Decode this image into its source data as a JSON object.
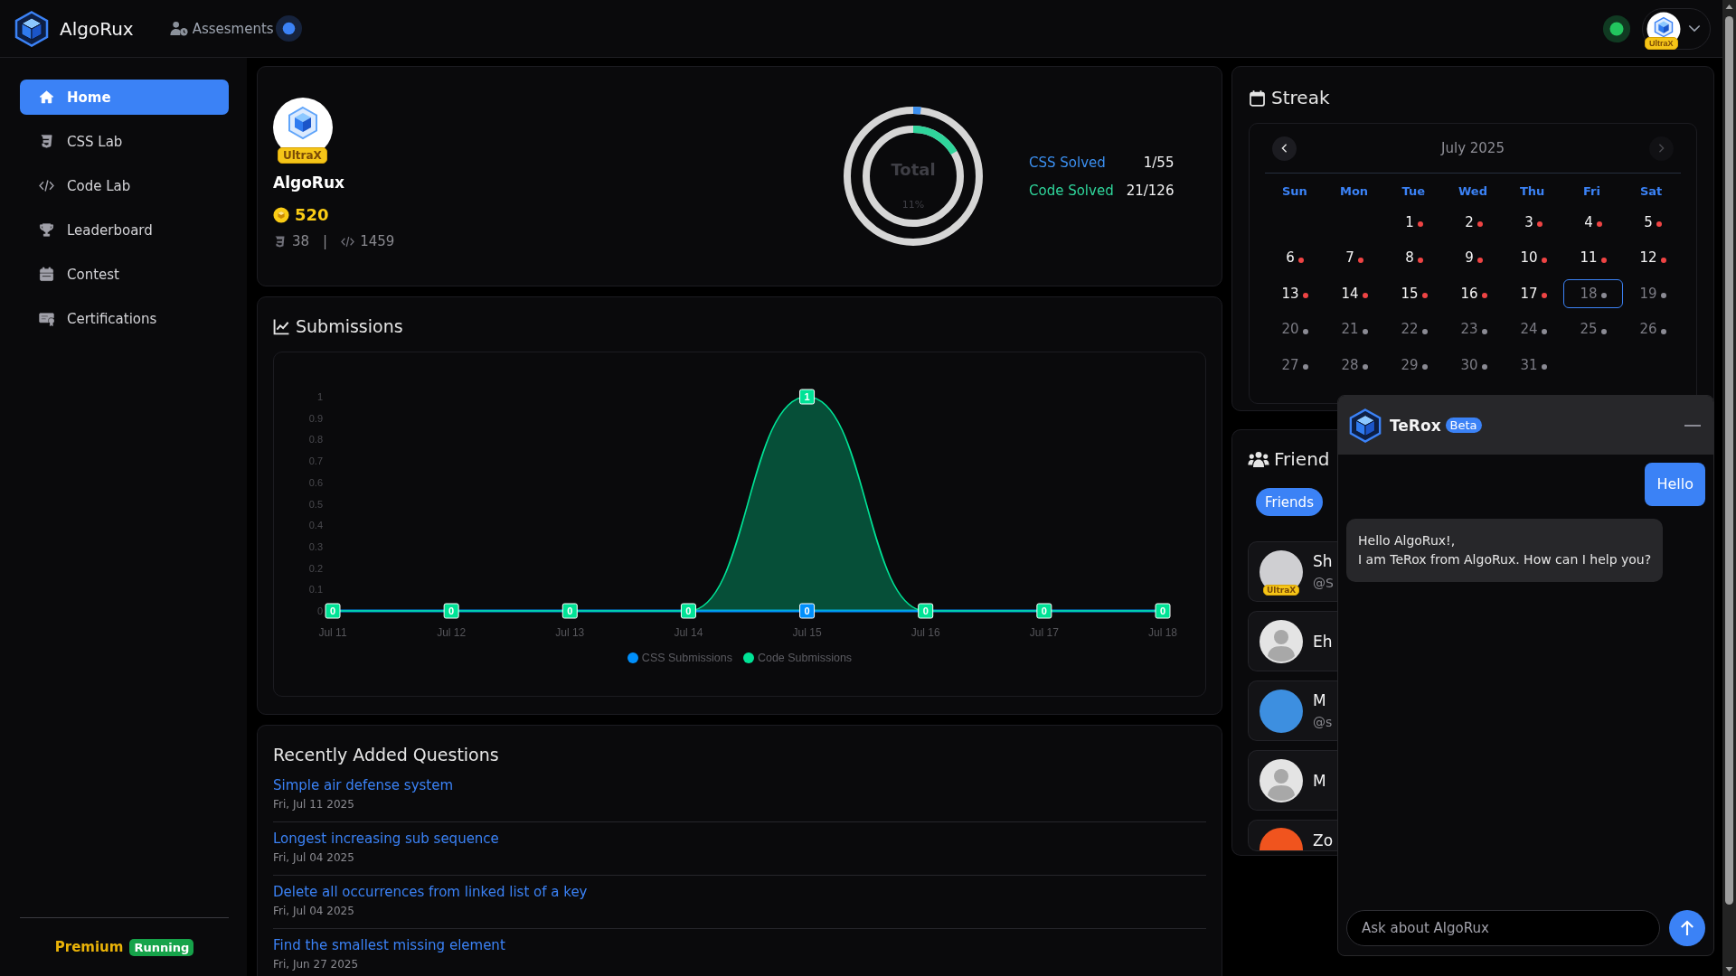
{
  "topbar": {
    "brand": "AlgoRux",
    "link": "Assesments",
    "account_badge": "UltraX"
  },
  "sidebar": {
    "items": [
      {
        "label": "Home",
        "selected": true
      },
      {
        "label": "CSS Lab",
        "selected": false
      },
      {
        "label": "Code Lab",
        "selected": false
      },
      {
        "label": "Leaderboard",
        "selected": false
      },
      {
        "label": "Contest",
        "selected": false
      },
      {
        "label": "Certifications",
        "selected": false
      }
    ],
    "plan": "Premium",
    "plan_status": "Running"
  },
  "profile": {
    "badge": "UltraX",
    "name": "AlgoRux",
    "coins": "520",
    "css_count": "38",
    "separator": "|",
    "code_count": "1459"
  },
  "progress": {
    "center_label": "Total",
    "percent": "11%",
    "rings": [
      {
        "label": "CSS Solved",
        "value": "1/55",
        "color": "#3b8ff0"
      },
      {
        "label": "Code Solved",
        "value": "21/126",
        "color": "#2fd59b"
      }
    ]
  },
  "streak": {
    "title": "Streak",
    "month": "July 2025",
    "prev_disabled": false,
    "next_disabled": true,
    "weekdays": [
      "Sun",
      "Mon",
      "Tue",
      "Wed",
      "Thu",
      "Fri",
      "Sat"
    ],
    "weeks": [
      [
        {
          "kind": "blank"
        },
        {
          "kind": "blank"
        },
        {
          "kind": "day",
          "day": "1",
          "past": true,
          "selected": false
        },
        {
          "kind": "day",
          "day": "2",
          "past": true,
          "selected": false
        },
        {
          "kind": "day",
          "day": "3",
          "past": true,
          "selected": false
        },
        {
          "kind": "day",
          "day": "4",
          "past": true,
          "selected": false
        },
        {
          "kind": "day",
          "day": "5",
          "past": true,
          "selected": false
        }
      ],
      [
        {
          "kind": "day",
          "day": "6",
          "past": true,
          "selected": false
        },
        {
          "kind": "day",
          "day": "7",
          "past": true,
          "selected": false
        },
        {
          "kind": "day",
          "day": "8",
          "past": true,
          "selected": false
        },
        {
          "kind": "day",
          "day": "9",
          "past": true,
          "selected": false
        },
        {
          "kind": "day",
          "day": "10",
          "past": true,
          "selected": false
        },
        {
          "kind": "day",
          "day": "11",
          "past": true,
          "selected": false
        },
        {
          "kind": "day",
          "day": "12",
          "past": true,
          "selected": false
        }
      ],
      [
        {
          "kind": "day",
          "day": "13",
          "past": true,
          "selected": false
        },
        {
          "kind": "day",
          "day": "14",
          "past": true,
          "selected": false
        },
        {
          "kind": "day",
          "day": "15",
          "past": true,
          "selected": false
        },
        {
          "kind": "day",
          "day": "16",
          "past": true,
          "selected": false
        },
        {
          "kind": "day",
          "day": "17",
          "past": true,
          "selected": false
        },
        {
          "kind": "day",
          "day": "18",
          "past": false,
          "selected": true
        },
        {
          "kind": "day",
          "day": "19",
          "past": false,
          "selected": false
        }
      ],
      [
        {
          "kind": "day",
          "day": "20",
          "past": false,
          "selected": false
        },
        {
          "kind": "day",
          "day": "21",
          "past": false,
          "selected": false
        },
        {
          "kind": "day",
          "day": "22",
          "past": false,
          "selected": false
        },
        {
          "kind": "day",
          "day": "23",
          "past": false,
          "selected": false
        },
        {
          "kind": "day",
          "day": "24",
          "past": false,
          "selected": false
        },
        {
          "kind": "day",
          "day": "25",
          "past": false,
          "selected": false
        },
        {
          "kind": "day",
          "day": "26",
          "past": false,
          "selected": false
        }
      ],
      [
        {
          "kind": "day",
          "day": "27",
          "past": false,
          "selected": false
        },
        {
          "kind": "day",
          "day": "28",
          "past": false,
          "selected": false
        },
        {
          "kind": "day",
          "day": "29",
          "past": false,
          "selected": false
        },
        {
          "kind": "day",
          "day": "30",
          "past": false,
          "selected": false
        },
        {
          "kind": "day",
          "day": "31",
          "past": false,
          "selected": false
        }
      ]
    ]
  },
  "submissions": {
    "title": "Submissions",
    "chart_data": {
      "type": "line",
      "categories": [
        "Jul 11",
        "Jul 12",
        "Jul 13",
        "Jul 14",
        "Jul 15",
        "Jul 16",
        "Jul 17",
        "Jul 18"
      ],
      "series": [
        {
          "name": "CSS Submissions",
          "color": "#008ffb",
          "values": [
            0,
            0,
            0,
            0,
            0,
            0,
            0,
            0
          ],
          "value_labels": [
            null,
            null,
            null,
            null,
            "0",
            null,
            null,
            null
          ]
        },
        {
          "name": "Code Submissions",
          "color": "#00e396",
          "marker": "square",
          "values": [
            0,
            0,
            0,
            0,
            1,
            0,
            0,
            0
          ],
          "value_labels": [
            "0",
            "0",
            "0",
            "0",
            "1",
            "0",
            "0",
            "0"
          ]
        }
      ],
      "ylim": [
        0,
        1
      ],
      "yticks": [
        0,
        0.1,
        0.2,
        0.3,
        0.4,
        0.5,
        0.6,
        0.7,
        0.8,
        0.9,
        1
      ],
      "legend": "bottom"
    }
  },
  "friends": {
    "title": "Friend",
    "tabs": [
      {
        "label": "Friends",
        "selected": true
      }
    ],
    "people": [
      {
        "kind": "photo",
        "name": "Sh",
        "handle": "@S",
        "badge": "UltraX"
      },
      {
        "kind": "default",
        "name": "Eh"
      },
      {
        "kind": "photo",
        "name": "M",
        "handle": "@s"
      },
      {
        "kind": "default",
        "name": "M"
      },
      {
        "kind": "photo",
        "name": "Zo"
      }
    ]
  },
  "chat": {
    "title": "TeRox",
    "badge": "Beta",
    "messages": [
      {
        "kind": "user",
        "lines": [
          "Hello"
        ]
      },
      {
        "kind": "bot",
        "lines": [
          "Hello AlgoRux!,",
          "I am TeRox from AlgoRux. How can I help you?"
        ]
      }
    ],
    "input": {
      "placeholder": "Ask about AlgoRux"
    }
  },
  "recent": {
    "title": "Recently Added Questions",
    "questions": [
      {
        "title": "Simple air defense system",
        "date": "Fri, Jul 11 2025"
      },
      {
        "title": "Longest increasing sub sequence",
        "date": "Fri, Jul 04 2025"
      },
      {
        "title": "Delete all occurrences from linked list of a key",
        "date": "Fri, Jul 04 2025"
      },
      {
        "title": "Find the smallest missing element",
        "date": "Fri, Jun 27 2025"
      }
    ]
  }
}
